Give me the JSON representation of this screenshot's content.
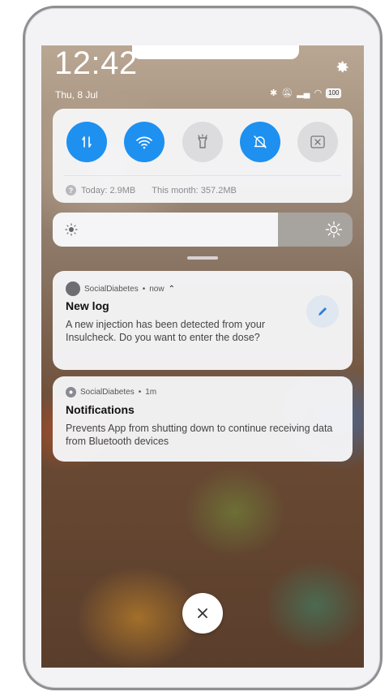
{
  "status_bar": {
    "time": "12:42",
    "date": "Thu, 8 Jul",
    "battery": "100"
  },
  "quick_settings": {
    "tiles": [
      {
        "name": "mobile-data",
        "active": true
      },
      {
        "name": "wifi",
        "active": true
      },
      {
        "name": "flashlight",
        "active": false
      },
      {
        "name": "silent",
        "active": true
      },
      {
        "name": "screenshot",
        "active": false
      }
    ],
    "usage_today": "Today: 2.9MB",
    "usage_month": "This month: 357.2MB"
  },
  "brightness": {
    "level": 0.75
  },
  "notifications": [
    {
      "app": "SocialDiabetes",
      "time": "now",
      "title": "New log",
      "body": "A new injection has been detected from your Insulcheck. Do you want to enter the dose?"
    },
    {
      "app": "SocialDiabetes",
      "time": "1m",
      "title": "Notifications",
      "body": "Prevents App from shutting down to continue receiving data from Bluetooth devices"
    }
  ],
  "colors": {
    "accent": "#1e90f0",
    "card_bg": "#f6f6f8",
    "tile_off": "#dcdcdf"
  }
}
